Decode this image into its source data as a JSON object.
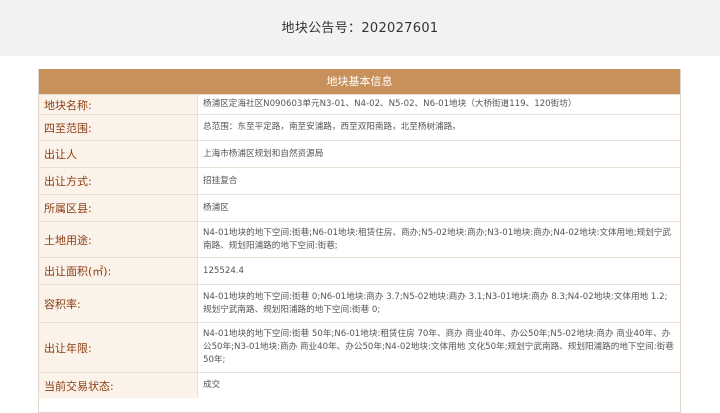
{
  "notice": {
    "title": "地块公告号：202027601"
  },
  "panel": {
    "header": "地块基本信息",
    "rows": [
      {
        "label": "地块名称:",
        "value": "杨浦区定海社区N090603单元N3-01、N4-02、N5-02、N6-01地块（大桥街道119、120街坊）"
      },
      {
        "label": "四至范围:",
        "value": "总范围：东至平定路，南至安浦路，西至双阳南路，北至杨树浦路。"
      },
      {
        "label": "出让人",
        "value": "上海市杨浦区规划和自然资源局"
      },
      {
        "label": "出让方式:",
        "value": "招挂复合"
      },
      {
        "label": "所属区县:",
        "value": "杨浦区"
      },
      {
        "label": "土地用途:",
        "value": "N4-01地块的地下空间:街巷;N6-01地块:租赁住房、商办;N5-02地块:商办;N3-01地块:商办;N4-02地块:文体用地;规划宁武南路、规划阳浦路的地下空间:街巷;"
      },
      {
        "label": "出让面积(㎡):",
        "value": "125524.4"
      },
      {
        "label": "容积率:",
        "value": "N4-01地块的地下空间:街巷 0;N6-01地块:商办 3.7;N5-02地块:商办 3.1;N3-01地块:商办 8.3;N4-02地块:文体用地 1.2;规划宁武南路、规划阳浦路的地下空间:街巷 0;"
      },
      {
        "label": "出让年限:",
        "value": "N4-01地块的地下空间:街巷 50年;N6-01地块:租赁住房 70年、商办 商业40年、办公50年;N5-02地块:商办 商业40年、办公50年;N3-01地块:商办 商业40年、办公50年;N4-02地块:文体用地 文化50年;规划宁武南路、规划阳浦路的地下空间:街巷 50年;"
      },
      {
        "label": "当前交易状态:",
        "value": "成交"
      }
    ]
  }
}
